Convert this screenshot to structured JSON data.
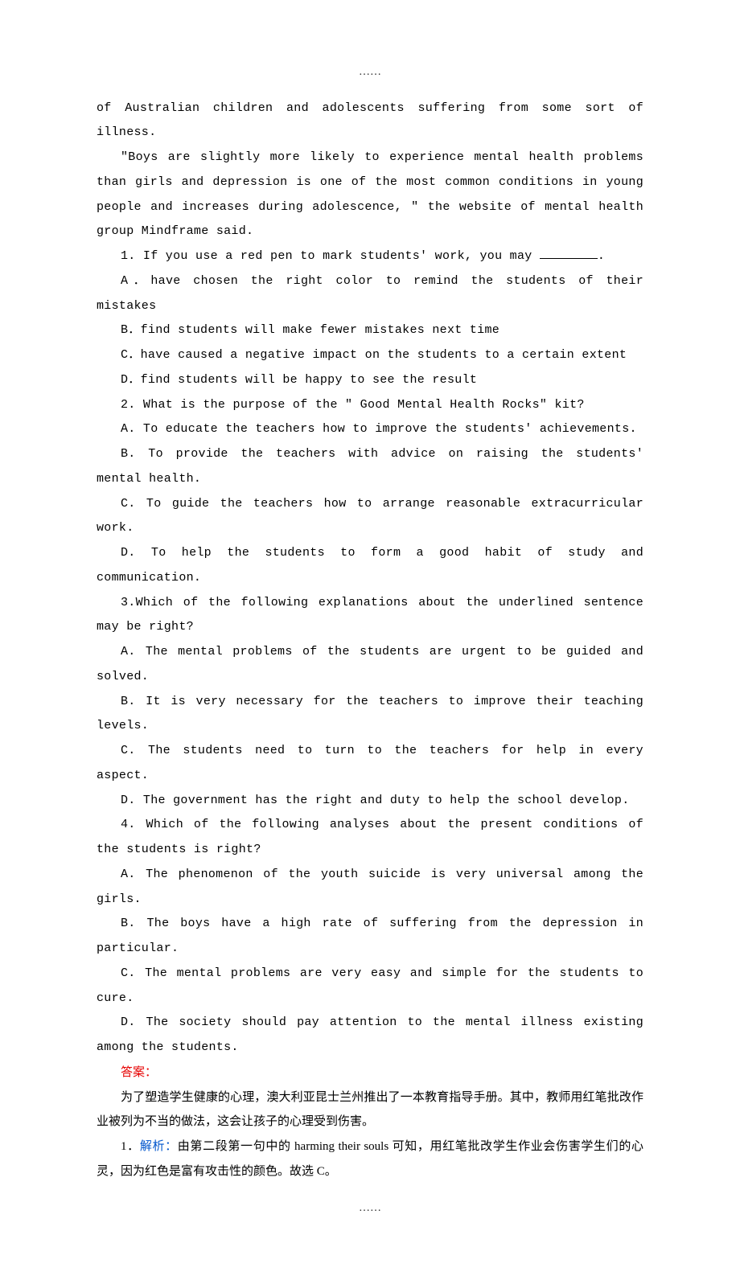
{
  "ellipsis_top": "……",
  "ellipsis_bottom": "……",
  "p_top": "of Australian children and adolescents suffering from some sort of illness.",
  "p_quote1": "\"Boys are slightly more likely to experience mental health problems than girls and depression is one of the most common conditions in young people and increases during adolescence, \" the website of mental health group Mindframe said.",
  "q1_stem_pre": "1. If you use a red pen to mark students' work, you may ",
  "q1_stem_post": ".",
  "q1_A": "A．have chosen the right color to remind the students of their mistakes",
  "q1_B": "B．find students will make fewer mistakes next time",
  "q1_C": "C．have caused a negative impact on the students to a certain extent",
  "q1_D": "D．find students will be happy to see the result",
  "q2_stem": "2. What is the purpose of the \" Good Mental Health Rocks\" kit?",
  "q2_A": "A. To educate the teachers how to improve the students' achievements.",
  "q2_B": "B. To provide the teachers with advice on raising the students' mental health.",
  "q2_C": "C. To guide the teachers how to arrange reasonable extracurricular work.",
  "q2_D": "D. To help the students to form a good habit of study and communication.",
  "q3_stem": "3.Which of the following explanations about the underlined sentence may be right?",
  "q3_A": "A. The mental problems of the students are urgent to be guided and solved.",
  "q3_B": "B. It is very necessary for the teachers to improve their teaching levels.",
  "q3_C": "C. The students need to turn to the teachers for help in every aspect.",
  "q3_D": "D. The government has the right and duty to help  the school develop.",
  "q4_stem": "4. Which of the following analyses about the present conditions of the students is right?",
  "q4_A": "A. The phenomenon of the youth suicide is very universal among the girls.",
  "q4_B": "B. The boys have a high rate of suffering from the  depression in particular.",
  "q4_C": "C. The mental problems are very easy and simple for the students to cure.",
  "q4_D": "D. The society should pay attention to the mental illness existing among the students.",
  "answer_label": "答案：",
  "answer_intro": "为了塑造学生健康的心理，澳大利亚昆士兰州推出了一本教育指导手册。其中，教师用红笔批改作业被列为不当的做法，这会让孩子的心理受到伤害。",
  "a1_prefix": "1．",
  "a1_label": "解析：",
  "a1_body": "由第二段第一句中的 harming their souls 可知，用红笔批改学生作业会伤害学生们的心灵，因为红色是富有攻击性的颜色。故选 C。"
}
